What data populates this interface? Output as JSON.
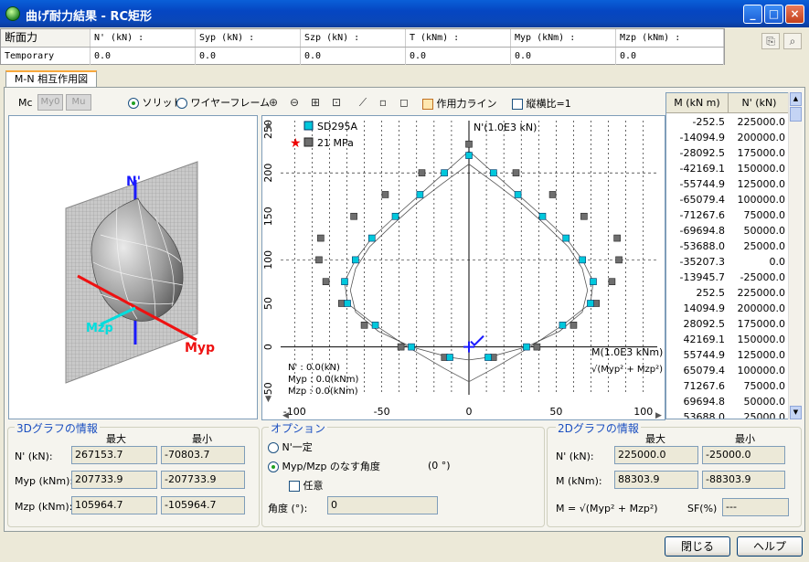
{
  "window": {
    "title": "曲げ耐力結果 - RC矩形",
    "min_label": "_",
    "max_label": "□",
    "close_label": "×"
  },
  "section_table": {
    "headers": [
      "断面力",
      "N' (kN) :",
      "Syp (kN) :",
      "Szp (kN) :",
      "T (kNm) :",
      "Myp (kNm) :",
      "Mzp (kNm) :"
    ],
    "row": [
      "Temporary",
      "0.0",
      "0.0",
      "0.0",
      "0.0",
      "0.0",
      "0.0"
    ]
  },
  "tab": {
    "label": "M-N 相互作用図"
  },
  "left_panel": {
    "mode_label": "Mc",
    "btn_my0": "My0",
    "btn_mu": "Mu",
    "radio_solid": "ソリッド",
    "radio_wire": "ワイヤーフレーム",
    "axis_n": "N'",
    "axis_mzp": "Mzp",
    "axis_myp": "Myp"
  },
  "plot_toolbar": {
    "chk_line": "作用力ライン",
    "chk_ratio": "縦横比=1"
  },
  "chart_data": {
    "type": "scatter",
    "legend": [
      {
        "name": "SD295A",
        "color": "#00c8dc"
      },
      {
        "name": "21 MPa",
        "color": "#6e6e6e"
      }
    ],
    "xlabel": "M(1.0E3 kNm)",
    "ylabel": "N'(1.0E3 kN)",
    "xlim": [
      -108,
      108
    ],
    "ylim": [
      -55,
      260
    ],
    "xticks": [
      -100,
      -50,
      0,
      50,
      100
    ],
    "yticks": [
      -50,
      0,
      50,
      100,
      150,
      200,
      250
    ],
    "outer_curve": [
      [
        0,
        225
      ],
      [
        -14.1,
        200
      ],
      [
        -28.1,
        175
      ],
      [
        -42.2,
        150
      ],
      [
        -55.7,
        125
      ],
      [
        -65.1,
        100
      ],
      [
        -71.3,
        75
      ],
      [
        -69.7,
        50
      ],
      [
        -53.7,
        25
      ],
      [
        -35.2,
        0
      ],
      [
        -13.9,
        -25
      ],
      [
        0,
        -40
      ],
      [
        13.9,
        -25
      ],
      [
        35.2,
        0
      ],
      [
        53.7,
        25
      ],
      [
        69.7,
        50
      ],
      [
        71.3,
        75
      ],
      [
        65.1,
        100
      ],
      [
        55.7,
        125
      ],
      [
        42.2,
        150
      ],
      [
        28.1,
        175
      ],
      [
        14.1,
        200
      ],
      [
        0,
        225
      ]
    ],
    "cyan_points": [
      [
        0,
        220
      ],
      [
        -14.1,
        200
      ],
      [
        -28.1,
        175
      ],
      [
        -42.2,
        150
      ],
      [
        -55.7,
        125
      ],
      [
        -65.1,
        100
      ],
      [
        -71.3,
        75
      ],
      [
        -69.7,
        50
      ],
      [
        -53.7,
        25
      ],
      [
        -33,
        0
      ],
      [
        -11,
        -12
      ],
      [
        14.1,
        200
      ],
      [
        28.1,
        175
      ],
      [
        42.2,
        150
      ],
      [
        55.7,
        125
      ],
      [
        65.1,
        100
      ],
      [
        71.3,
        75
      ],
      [
        69.7,
        50
      ],
      [
        53.7,
        25
      ],
      [
        33,
        0
      ],
      [
        11,
        -12
      ]
    ],
    "gray_points": [
      [
        0,
        233
      ],
      [
        -27,
        200
      ],
      [
        -48,
        175
      ],
      [
        -66,
        150
      ],
      [
        -85,
        125
      ],
      [
        -86,
        100
      ],
      [
        -82,
        75
      ],
      [
        -73,
        50
      ],
      [
        -60,
        25
      ],
      [
        -39,
        0
      ],
      [
        -14,
        -12
      ],
      [
        27,
        200
      ],
      [
        48,
        175
      ],
      [
        66,
        150
      ],
      [
        85,
        125
      ],
      [
        86,
        100
      ],
      [
        82,
        75
      ],
      [
        73,
        50
      ],
      [
        60,
        25
      ],
      [
        39,
        0
      ],
      [
        14,
        -12
      ]
    ],
    "inner_curve": [
      [
        0,
        210
      ],
      [
        -15,
        188
      ],
      [
        -30,
        165
      ],
      [
        -44,
        140
      ],
      [
        -57,
        115
      ],
      [
        -65,
        90
      ],
      [
        -68,
        65
      ],
      [
        -65,
        40
      ],
      [
        -52,
        18
      ],
      [
        -33,
        0
      ],
      [
        -11,
        -12
      ],
      [
        0,
        -15
      ],
      [
        11,
        -12
      ],
      [
        33,
        0
      ],
      [
        52,
        18
      ],
      [
        65,
        40
      ],
      [
        68,
        65
      ],
      [
        65,
        90
      ],
      [
        57,
        115
      ],
      [
        44,
        140
      ],
      [
        30,
        165
      ],
      [
        15,
        188
      ],
      [
        0,
        210
      ]
    ],
    "readout": {
      "n": "N' : 0.0(kN)",
      "myp": "Myp : 0.0(kNm)",
      "mzp": "Mzp : 0.0(kNm)"
    },
    "formula": "√(Myp² + Mzp²)"
  },
  "mn_table": {
    "headers": [
      "M (kN m)",
      "N' (kN)"
    ],
    "rows": [
      [
        "-252.5",
        "225000.0"
      ],
      [
        "-14094.9",
        "200000.0"
      ],
      [
        "-28092.5",
        "175000.0"
      ],
      [
        "-42169.1",
        "150000.0"
      ],
      [
        "-55744.9",
        "125000.0"
      ],
      [
        "-65079.4",
        "100000.0"
      ],
      [
        "-71267.6",
        "75000.0"
      ],
      [
        "-69694.8",
        "50000.0"
      ],
      [
        "-53688.0",
        "25000.0"
      ],
      [
        "-35207.3",
        "0.0"
      ],
      [
        "-13945.7",
        "-25000.0"
      ],
      [
        "252.5",
        "225000.0"
      ],
      [
        "14094.9",
        "200000.0"
      ],
      [
        "28092.5",
        "175000.0"
      ],
      [
        "42169.1",
        "150000.0"
      ],
      [
        "55744.9",
        "125000.0"
      ],
      [
        "65079.4",
        "100000.0"
      ],
      [
        "71267.6",
        "75000.0"
      ],
      [
        "69694.8",
        "50000.0"
      ],
      [
        "53688.0",
        "25000.0"
      ]
    ]
  },
  "info3d": {
    "title": "3Dグラフの情報",
    "col_max": "最大",
    "col_min": "最小",
    "rows": [
      {
        "label": "N' (kN):",
        "max": "267153.7",
        "min": "-70803.7"
      },
      {
        "label": "Myp (kNm):",
        "max": "207733.9",
        "min": "-207733.9"
      },
      {
        "label": "Mzp (kNm):",
        "max": "105964.7",
        "min": "-105964.7"
      }
    ]
  },
  "options": {
    "title": "オプション",
    "radio_n": "N'一定",
    "radio_angle": "Myp/Mzp のなす角度",
    "angle_value": "(0 °)",
    "chk_any": "任意",
    "angle_label": "角度 (°):",
    "angle_input": "0"
  },
  "info2d": {
    "title": "2Dグラフの情報",
    "col_max": "最大",
    "col_min": "最小",
    "rows": [
      {
        "label": "N' (kN):",
        "max": "225000.0",
        "min": "-25000.0"
      },
      {
        "label": "M (kNm):",
        "max": "88303.9",
        "min": "-88303.9"
      }
    ],
    "formula": "M = √(Myp² + Mzp²)",
    "sf_label": "SF(%)",
    "sf_value": "---"
  },
  "buttons": {
    "close": "閉じる",
    "help": "ヘルプ"
  }
}
